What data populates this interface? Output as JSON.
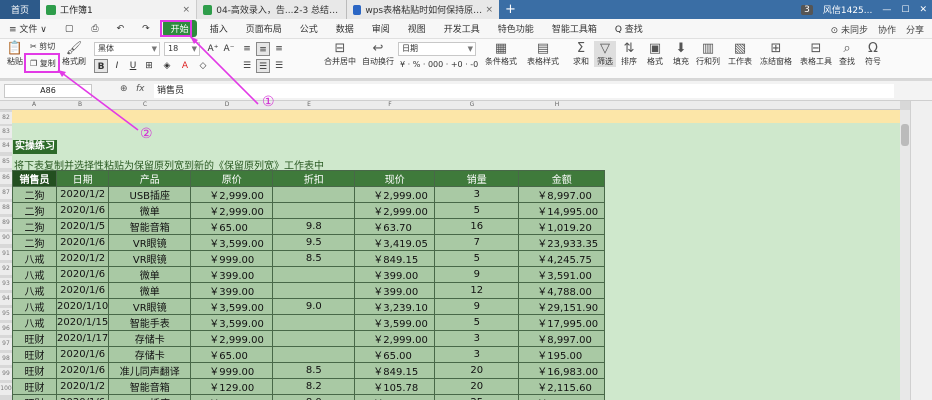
{
  "tabs": {
    "home": "首页",
    "t1": "工作簿1",
    "t2": "04-高效录入，告...2-3 总结练习)",
    "t3": "wps表格粘贴时如何保持原列宽不变",
    "plus": "+"
  },
  "titlebar_right": {
    "badge": "3",
    "user": "风信1425..."
  },
  "menu": {
    "file": "≡ 文件 ∨",
    "items": [
      "开始",
      "插入",
      "页面布局",
      "公式",
      "数据",
      "审阅",
      "视图",
      "开发工具",
      "特色功能",
      "智能工具箱",
      "Q 查找"
    ],
    "right": [
      "⊙ 未同步",
      "协作",
      "分享"
    ]
  },
  "ribbon": {
    "paste": "粘贴",
    "cut": "剪切",
    "copy": "复制",
    "format_painter": "格式刷",
    "font_name": "黑体",
    "font_size": "18",
    "merge": "合并居中",
    "wrap": "自动换行",
    "number_format": "日期",
    "cond_format": "条件格式",
    "table_style": "表格样式",
    "sum": "求和",
    "filter": "筛选",
    "sort": "排序",
    "format": "格式",
    "fill": "填充",
    "rowcol": "行和列",
    "worksheet": "工作表",
    "freeze": "冻结窗格",
    "tools": "表格工具",
    "find": "查找",
    "symbol": "符号"
  },
  "formula_bar": {
    "cell": "A86",
    "value": "销售员"
  },
  "columns": [
    "A",
    "B",
    "C",
    "D",
    "E",
    "F",
    "G",
    "H"
  ],
  "rows": [
    "82",
    "83",
    "84",
    "85",
    "86",
    "87",
    "88",
    "89",
    "90",
    "91",
    "92",
    "93",
    "94",
    "95",
    "96",
    "97",
    "98",
    "99",
    "100"
  ],
  "practice_title": "实操练习",
  "instruction": "将下表复制并选择性粘贴为保留原列宽到新的《保留原列宽》工作表中",
  "table": {
    "headers": [
      "销售员",
      "日期",
      "产品",
      "原价",
      "折扣",
      "现价",
      "销量",
      "金额"
    ],
    "rows": [
      [
        "二狗",
        "2020/1/2",
        "USB插座",
        "￥2,999.00",
        "",
        "￥2,999.00",
        "3",
        "￥8,997.00"
      ],
      [
        "二狗",
        "2020/1/6",
        "微单",
        "￥2,999.00",
        "",
        "￥2,999.00",
        "5",
        "￥14,995.00"
      ],
      [
        "二狗",
        "2020/1/5",
        "智能音箱",
        "￥65.00",
        "9.8",
        "￥63.70",
        "16",
        "￥1,019.20"
      ],
      [
        "二狗",
        "2020/1/6",
        "VR眼镜",
        "￥3,599.00",
        "9.5",
        "￥3,419.05",
        "7",
        "￥23,933.35"
      ],
      [
        "八戒",
        "2020/1/2",
        "VR眼镜",
        "￥999.00",
        "8.5",
        "￥849.15",
        "5",
        "￥4,245.75"
      ],
      [
        "八戒",
        "2020/1/6",
        "微单",
        "￥399.00",
        "",
        "￥399.00",
        "9",
        "￥3,591.00"
      ],
      [
        "八戒",
        "2020/1/6",
        "微单",
        "￥399.00",
        "",
        "￥399.00",
        "12",
        "￥4,788.00"
      ],
      [
        "八戒",
        "2020/1/10",
        "VR眼镜",
        "￥3,599.00",
        "9.0",
        "￥3,239.10",
        "9",
        "￥29,151.90"
      ],
      [
        "八戒",
        "2020/1/15",
        "智能手表",
        "￥3,599.00",
        "",
        "￥3,599.00",
        "5",
        "￥17,995.00"
      ],
      [
        "旺财",
        "2020/1/17",
        "存储卡",
        "￥2,999.00",
        "",
        "￥2,999.00",
        "3",
        "￥8,997.00"
      ],
      [
        "旺财",
        "2020/1/6",
        "存储卡",
        "￥65.00",
        "",
        "￥65.00",
        "3",
        "￥195.00"
      ],
      [
        "旺财",
        "2020/1/6",
        "准儿同声翻译",
        "￥999.00",
        "8.5",
        "￥849.15",
        "20",
        "￥16,983.00"
      ],
      [
        "旺财",
        "2020/1/2",
        "智能音箱",
        "￥129.00",
        "8.2",
        "￥105.78",
        "20",
        "￥2,115.60"
      ],
      [
        "旺财",
        "2020/1/6",
        "USB插座",
        "￥129.00",
        "8.0",
        "￥103.20",
        "25",
        "￥2,580.00"
      ]
    ]
  },
  "annotations": {
    "one": "①",
    "two": "②"
  },
  "colors": {
    "accent": "#2e8b3e",
    "annotation": "#e23ae6",
    "header_dark": "#234f20",
    "cell": "#a9c9a4"
  }
}
